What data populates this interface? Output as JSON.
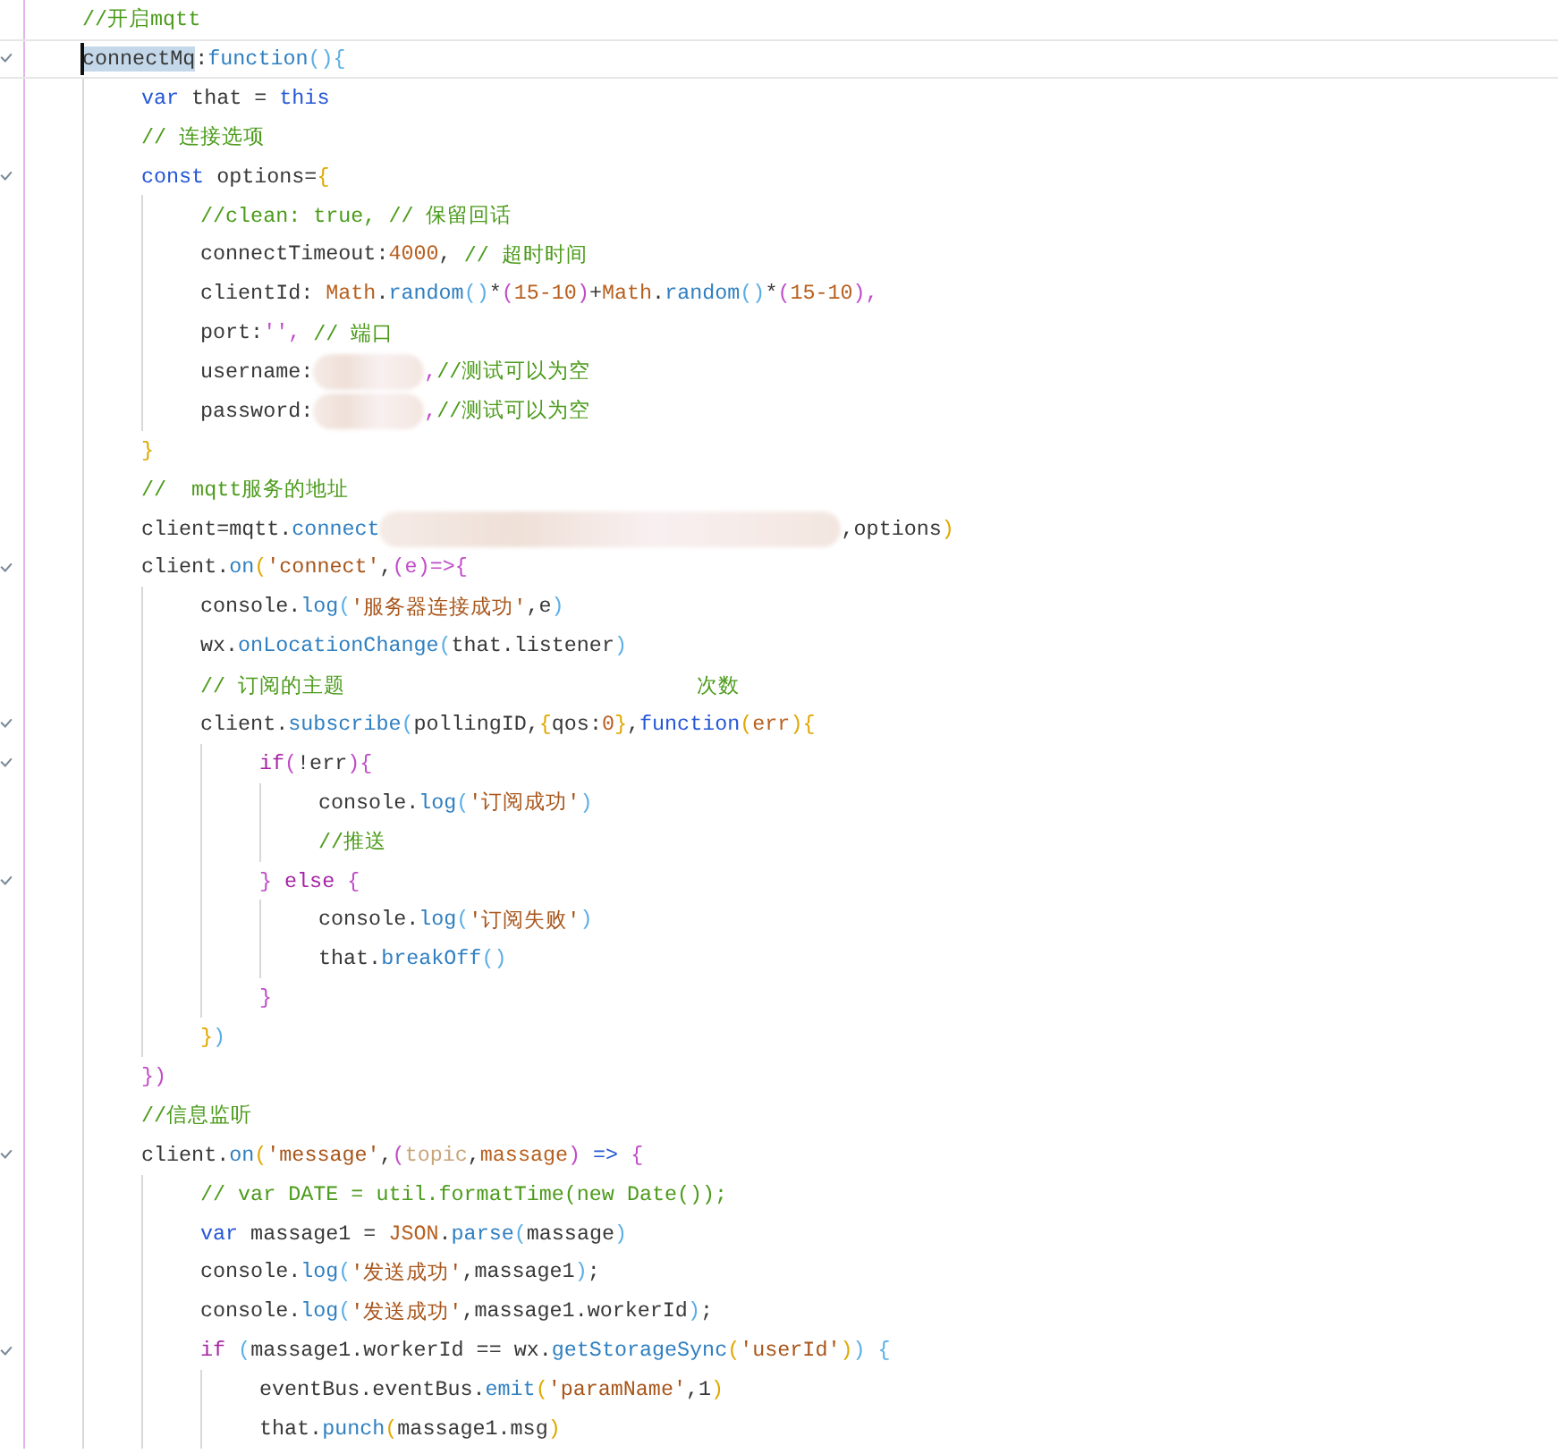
{
  "lines": [
    {
      "fold": false,
      "current": false,
      "tokens": [
        {
          "kind": "cm",
          "text": "//开启mqtt"
        }
      ]
    },
    {
      "fold": true,
      "current": true,
      "tokens": [
        {
          "kind": "id",
          "text": "connectMq",
          "selected": true
        },
        {
          "kind": "id",
          "text": ":"
        },
        {
          "kind": "fn",
          "text": "function"
        },
        {
          "kind": "pb",
          "text": "(){"
        }
      ]
    },
    {
      "fold": false,
      "current": false,
      "tokens": [
        {
          "kind": "kw",
          "text": "    var"
        },
        {
          "kind": "id",
          "text": " that = "
        },
        {
          "kind": "kw",
          "text": "this"
        }
      ]
    },
    {
      "fold": false,
      "current": false,
      "tokens": [
        {
          "kind": "cm",
          "text": "    // 连接选项"
        }
      ]
    },
    {
      "fold": true,
      "current": false,
      "tokens": [
        {
          "kind": "kw",
          "text": "    const"
        },
        {
          "kind": "id",
          "text": " options="
        },
        {
          "kind": "yb",
          "text": "{"
        }
      ]
    },
    {
      "fold": false,
      "current": false,
      "tokens": [
        {
          "kind": "cm",
          "text": "        //clean: true, // 保留回话"
        }
      ]
    },
    {
      "fold": false,
      "current": false,
      "tokens": [
        {
          "kind": "id",
          "text": "        connectTimeout:"
        },
        {
          "kind": "num",
          "text": "4000"
        },
        {
          "kind": "id",
          "text": ", "
        },
        {
          "kind": "cm",
          "text": "// 超时时间"
        }
      ]
    },
    {
      "fold": false,
      "current": false,
      "tokens": [
        {
          "kind": "id",
          "text": "        clientId: "
        },
        {
          "kind": "num",
          "text": "Math"
        },
        {
          "kind": "id",
          "text": "."
        },
        {
          "kind": "fn",
          "text": "random"
        },
        {
          "kind": "pb",
          "text": "()"
        },
        {
          "kind": "id",
          "text": "*"
        },
        {
          "kind": "mb",
          "text": "("
        },
        {
          "kind": "num",
          "text": "15-10"
        },
        {
          "kind": "mb",
          "text": ")"
        },
        {
          "kind": "id",
          "text": "+"
        },
        {
          "kind": "num",
          "text": "Math"
        },
        {
          "kind": "id",
          "text": "."
        },
        {
          "kind": "fn",
          "text": "random"
        },
        {
          "kind": "pb",
          "text": "()"
        },
        {
          "kind": "id",
          "text": "*"
        },
        {
          "kind": "mb",
          "text": "("
        },
        {
          "kind": "num",
          "text": "15-10"
        },
        {
          "kind": "mb",
          "text": ")"
        },
        {
          "kind": "mb",
          "text": ","
        }
      ]
    },
    {
      "fold": false,
      "current": false,
      "tokens": [
        {
          "kind": "id",
          "text": "        port:"
        },
        {
          "kind": "mb",
          "text": "''"
        },
        {
          "kind": "mb",
          "text": ", "
        },
        {
          "kind": "cm",
          "text": "// 端口"
        }
      ]
    },
    {
      "fold": false,
      "current": false,
      "tokens": [
        {
          "kind": "id",
          "text": "        username:"
        },
        {
          "kind": "blur-short"
        },
        {
          "kind": "mb",
          "text": ","
        },
        {
          "kind": "cm",
          "text": "//测试可以为空"
        }
      ]
    },
    {
      "fold": false,
      "current": false,
      "tokens": [
        {
          "kind": "id",
          "text": "        password:"
        },
        {
          "kind": "blur-short"
        },
        {
          "kind": "mb",
          "text": ","
        },
        {
          "kind": "cm",
          "text": "//测试可以为空"
        }
      ]
    },
    {
      "fold": false,
      "current": false,
      "tokens": [
        {
          "kind": "yb",
          "text": "    }"
        }
      ]
    },
    {
      "fold": false,
      "current": false,
      "tokens": [
        {
          "kind": "cm",
          "text": "    //  mqtt服务的地址"
        }
      ]
    },
    {
      "fold": false,
      "current": false,
      "tokens": [
        {
          "kind": "id",
          "text": "    client=mqtt."
        },
        {
          "kind": "fn",
          "text": "connect"
        },
        {
          "kind": "blur-long"
        },
        {
          "kind": "id",
          "text": ",options"
        },
        {
          "kind": "yb",
          "text": ")"
        }
      ]
    },
    {
      "fold": true,
      "current": false,
      "tokens": [
        {
          "kind": "id",
          "text": "    client."
        },
        {
          "kind": "fn",
          "text": "on"
        },
        {
          "kind": "yb",
          "text": "("
        },
        {
          "kind": "str",
          "text": "'connect'"
        },
        {
          "kind": "id",
          "text": ","
        },
        {
          "kind": "mb",
          "text": "(e)=>{"
        }
      ]
    },
    {
      "fold": false,
      "current": false,
      "tokens": [
        {
          "kind": "id",
          "text": "        console."
        },
        {
          "kind": "fn",
          "text": "log"
        },
        {
          "kind": "pb",
          "text": "("
        },
        {
          "kind": "str",
          "text": "'服务器连接成功'"
        },
        {
          "kind": "id",
          "text": ",e"
        },
        {
          "kind": "pb",
          "text": ")"
        }
      ]
    },
    {
      "fold": false,
      "current": false,
      "tokens": [
        {
          "kind": "id",
          "text": "        wx."
        },
        {
          "kind": "fn",
          "text": "onLocationChange"
        },
        {
          "kind": "pb",
          "text": "("
        },
        {
          "kind": "id",
          "text": "that.listener"
        },
        {
          "kind": "pb",
          "text": ")"
        }
      ]
    },
    {
      "fold": false,
      "current": false,
      "tokens": [
        {
          "kind": "cm",
          "text": "        // 订阅的主题                            次数"
        }
      ]
    },
    {
      "fold": true,
      "current": false,
      "tokens": [
        {
          "kind": "id",
          "text": "        client."
        },
        {
          "kind": "fn",
          "text": "subscribe"
        },
        {
          "kind": "pb",
          "text": "("
        },
        {
          "kind": "id",
          "text": "pollingID,"
        },
        {
          "kind": "yb",
          "text": "{"
        },
        {
          "kind": "id",
          "text": "qos:"
        },
        {
          "kind": "num",
          "text": "0"
        },
        {
          "kind": "yb",
          "text": "}"
        },
        {
          "kind": "id",
          "text": ","
        },
        {
          "kind": "kw",
          "text": "function"
        },
        {
          "kind": "yb",
          "text": "("
        },
        {
          "kind": "num",
          "text": "err"
        },
        {
          "kind": "yb",
          "text": "){"
        }
      ]
    },
    {
      "fold": true,
      "current": false,
      "tokens": [
        {
          "kind": "ctl",
          "text": "            if"
        },
        {
          "kind": "mb",
          "text": "("
        },
        {
          "kind": "id",
          "text": "!err"
        },
        {
          "kind": "mb",
          "text": "){"
        }
      ]
    },
    {
      "fold": false,
      "current": false,
      "tokens": [
        {
          "kind": "id",
          "text": "                console."
        },
        {
          "kind": "fn",
          "text": "log"
        },
        {
          "kind": "pb",
          "text": "("
        },
        {
          "kind": "str",
          "text": "'订阅成功'"
        },
        {
          "kind": "pb",
          "text": ")"
        }
      ]
    },
    {
      "fold": false,
      "current": false,
      "tokens": [
        {
          "kind": "cm",
          "text": "                //推送"
        }
      ]
    },
    {
      "fold": true,
      "current": false,
      "tokens": [
        {
          "kind": "mb",
          "text": "            }"
        },
        {
          "kind": "ctl",
          "text": " else"
        },
        {
          "kind": "mb",
          "text": " {"
        }
      ]
    },
    {
      "fold": false,
      "current": false,
      "tokens": [
        {
          "kind": "id",
          "text": "                console."
        },
        {
          "kind": "fn",
          "text": "log"
        },
        {
          "kind": "pb",
          "text": "("
        },
        {
          "kind": "str",
          "text": "'订阅失败'"
        },
        {
          "kind": "pb",
          "text": ")"
        }
      ]
    },
    {
      "fold": false,
      "current": false,
      "tokens": [
        {
          "kind": "id",
          "text": "                that."
        },
        {
          "kind": "fn",
          "text": "breakOff"
        },
        {
          "kind": "pb",
          "text": "()"
        }
      ]
    },
    {
      "fold": false,
      "current": false,
      "tokens": [
        {
          "kind": "mb",
          "text": "            }"
        }
      ]
    },
    {
      "fold": false,
      "current": false,
      "tokens": [
        {
          "kind": "yb",
          "text": "        }"
        },
        {
          "kind": "pb",
          "text": ")"
        }
      ]
    },
    {
      "fold": false,
      "current": false,
      "tokens": [
        {
          "kind": "mb",
          "text": "    })"
        }
      ]
    },
    {
      "fold": false,
      "current": false,
      "tokens": [
        {
          "kind": "cm",
          "text": "    //信息监听"
        }
      ]
    },
    {
      "fold": true,
      "current": false,
      "tokens": [
        {
          "kind": "id",
          "text": "    client."
        },
        {
          "kind": "fn",
          "text": "on"
        },
        {
          "kind": "yb",
          "text": "("
        },
        {
          "kind": "str",
          "text": "'message'"
        },
        {
          "kind": "id",
          "text": ","
        },
        {
          "kind": "mb",
          "text": "("
        },
        {
          "kind": "prm",
          "text": "topic"
        },
        {
          "kind": "id",
          "text": ","
        },
        {
          "kind": "num",
          "text": "massage"
        },
        {
          "kind": "mb",
          "text": ")"
        },
        {
          "kind": "kw",
          "text": " =>"
        },
        {
          "kind": "mb",
          "text": " {"
        }
      ]
    },
    {
      "fold": false,
      "current": false,
      "tokens": [
        {
          "kind": "cm",
          "text": "        // var DATE = util.formatTime(new Date());"
        }
      ]
    },
    {
      "fold": false,
      "current": false,
      "tokens": [
        {
          "kind": "kw",
          "text": "        var"
        },
        {
          "kind": "id",
          "text": " massage1 = "
        },
        {
          "kind": "num",
          "text": "JSON"
        },
        {
          "kind": "id",
          "text": "."
        },
        {
          "kind": "fn",
          "text": "parse"
        },
        {
          "kind": "pb",
          "text": "("
        },
        {
          "kind": "id",
          "text": "massage"
        },
        {
          "kind": "pb",
          "text": ")"
        }
      ]
    },
    {
      "fold": false,
      "current": false,
      "tokens": [
        {
          "kind": "id",
          "text": "        console."
        },
        {
          "kind": "fn",
          "text": "log"
        },
        {
          "kind": "pb",
          "text": "("
        },
        {
          "kind": "str",
          "text": "'发送成功'"
        },
        {
          "kind": "id",
          "text": ",massage1"
        },
        {
          "kind": "pb",
          "text": ")"
        },
        {
          "kind": "id",
          "text": ";"
        }
      ]
    },
    {
      "fold": false,
      "current": false,
      "tokens": [
        {
          "kind": "id",
          "text": "        console."
        },
        {
          "kind": "fn",
          "text": "log"
        },
        {
          "kind": "pb",
          "text": "("
        },
        {
          "kind": "str",
          "text": "'发送成功'"
        },
        {
          "kind": "id",
          "text": ",massage1.workerId"
        },
        {
          "kind": "pb",
          "text": ")"
        },
        {
          "kind": "id",
          "text": ";"
        }
      ]
    },
    {
      "fold": true,
      "current": false,
      "tokens": [
        {
          "kind": "ctl",
          "text": "        if"
        },
        {
          "kind": "pb",
          "text": " ("
        },
        {
          "kind": "id",
          "text": "massage1.workerId == wx."
        },
        {
          "kind": "fn",
          "text": "getStorageSync"
        },
        {
          "kind": "yb",
          "text": "("
        },
        {
          "kind": "str",
          "text": "'userId'"
        },
        {
          "kind": "yb",
          "text": ")"
        },
        {
          "kind": "pb",
          "text": ")"
        },
        {
          "kind": "pb",
          "text": " {"
        }
      ]
    },
    {
      "fold": false,
      "current": false,
      "tokens": [
        {
          "kind": "id",
          "text": "            eventBus.eventBus."
        },
        {
          "kind": "fn",
          "text": "emit"
        },
        {
          "kind": "yb",
          "text": "("
        },
        {
          "kind": "str",
          "text": "'paramName'"
        },
        {
          "kind": "id",
          "text": ",1"
        },
        {
          "kind": "yb",
          "text": ")"
        }
      ]
    },
    {
      "fold": false,
      "current": false,
      "tokens": [
        {
          "kind": "id",
          "text": "            that."
        },
        {
          "kind": "fn",
          "text": "punch"
        },
        {
          "kind": "yb",
          "text": "("
        },
        {
          "kind": "id",
          "text": "massage1.msg"
        },
        {
          "kind": "yb",
          "text": ")"
        }
      ]
    }
  ]
}
